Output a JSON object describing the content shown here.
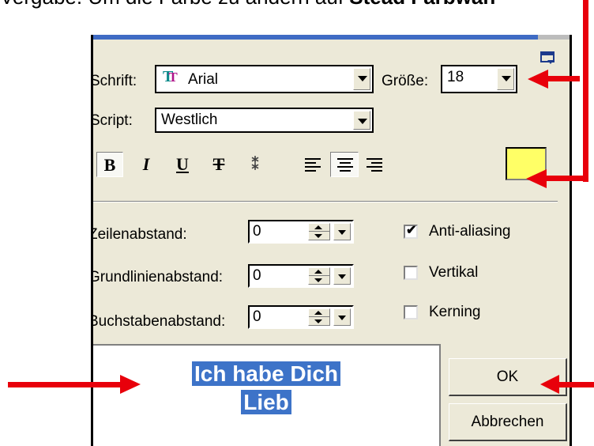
{
  "instruction": {
    "prefix": "Vergabe. Um die Farbe zu ändern auf ",
    "bold": "Stead Farbwah"
  },
  "dialog": {
    "font_label": "Schrift:",
    "font_value": "Arial",
    "size_label": "Größe:",
    "size_value": "18",
    "script_label": "Script:",
    "script_value": "Westlich",
    "format_buttons": [
      "B",
      "I",
      "U",
      "T",
      "⁑"
    ],
    "color_value": "#ffff66",
    "line_spacing_label": "Zeilenabstand:",
    "line_spacing_value": "0",
    "baseline_label": "Grundlinienabstand:",
    "baseline_value": "0",
    "char_spacing_label": "Buchstabenabstand:",
    "char_spacing_value": "0",
    "antialias_label": "Anti-aliasing",
    "antialias_checked": true,
    "vertical_label": "Vertikal",
    "vertical_checked": false,
    "kerning_label": "Kerning",
    "kerning_checked": false,
    "preview_line1": "Ich habe Dich",
    "preview_line2": "Lieb",
    "ok_label": "OK",
    "cancel_label": "Abbrechen"
  },
  "colors": {
    "annotation_arrow": "#e8000b",
    "selection": "#3d73c8",
    "dialog_bg": "#ece9d8"
  }
}
